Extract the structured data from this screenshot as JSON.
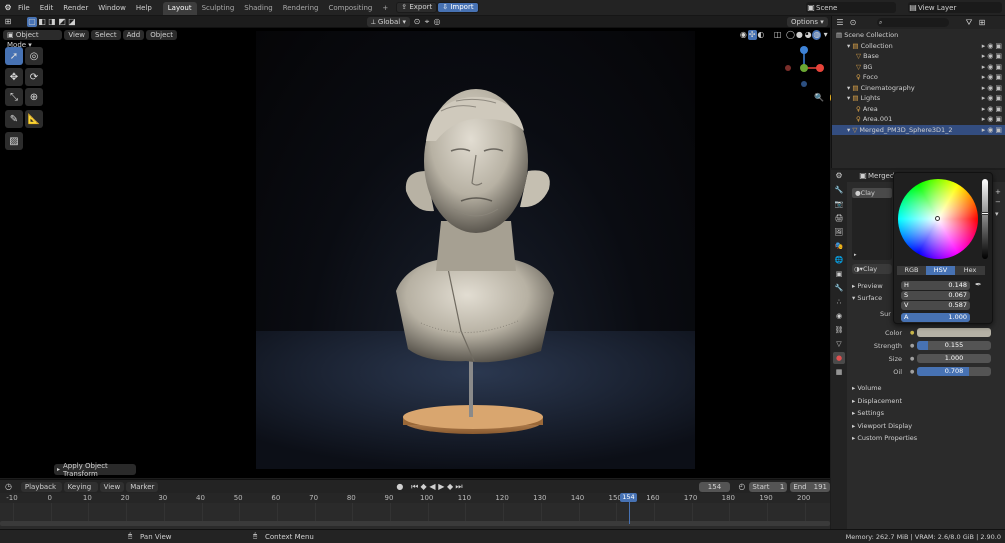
{
  "topbar": {
    "menus": [
      "File",
      "Edit",
      "Render",
      "Window",
      "Help"
    ],
    "workspaces": [
      "Layout",
      "Sculpting",
      "Shading",
      "Rendering",
      "Compositing"
    ],
    "active_workspace": "Layout",
    "add_workspace": "+",
    "export_label": "Export",
    "import_label": "Import",
    "scene_label": "Scene",
    "view_layer_label": "View Layer"
  },
  "viewport": {
    "mode": "Object Mode",
    "menus": [
      "View",
      "Select",
      "Add",
      "Object"
    ],
    "orientation": "Global",
    "options_label": "Options",
    "operator_panel": "Apply Object Transform",
    "gizmo_axes": [
      "X",
      "Y",
      "Z"
    ]
  },
  "timeline": {
    "menus": [
      "Playback",
      "Keying",
      "View",
      "Marker"
    ],
    "current_frame": "154",
    "start_label": "Start",
    "start": "1",
    "end_label": "End",
    "end": "191",
    "ruler": [
      "-10",
      "0",
      "10",
      "20",
      "30",
      "40",
      "50",
      "60",
      "70",
      "80",
      "90",
      "100",
      "110",
      "120",
      "130",
      "140",
      "150",
      "160",
      "170",
      "180",
      "190",
      "200"
    ],
    "playhead_label": "154"
  },
  "statusbar": {
    "left_hint": "Pan View",
    "right_hint": "Context Menu",
    "memory": "Memory: 262.7 MiB | VRAM: 2.6/8.0 GiB | 2.90.0"
  },
  "outliner": {
    "root": "Scene Collection",
    "rows": [
      {
        "label": "Collection",
        "indent": 1,
        "selected": false
      },
      {
        "label": "Base",
        "indent": 2,
        "selected": false
      },
      {
        "label": "BG",
        "indent": 2,
        "selected": false
      },
      {
        "label": "Foco",
        "indent": 2,
        "selected": false
      },
      {
        "label": "Cinematography",
        "indent": 1,
        "selected": false
      },
      {
        "label": "Lights",
        "indent": 1,
        "selected": false
      },
      {
        "label": "Area",
        "indent": 2,
        "selected": false
      },
      {
        "label": "Area.001",
        "indent": 2,
        "selected": false
      },
      {
        "label": "Merged_PM3D_Sphere3D1_2",
        "indent": 1,
        "selected": true
      }
    ]
  },
  "properties": {
    "object_name": "Merged",
    "material_slot": "Clay",
    "material_name": "Clay",
    "preview_label": "Preview",
    "surface_label": "Surface",
    "surface_field_label": "Sur",
    "color_label": "Color",
    "color_value": "#b6b2a6",
    "strength_label": "Strength",
    "strength": "0.155",
    "strength_fraction": 0.155,
    "size_label": "Size",
    "size": "1.000",
    "size_fraction": 0.0,
    "oil_label": "Oil",
    "oil": "0.708",
    "oil_fraction": 0.708,
    "sections": [
      "Volume",
      "Displacement",
      "Settings",
      "Viewport Display",
      "Custom Properties"
    ]
  },
  "color_picker": {
    "modes": [
      "RGB",
      "HSV",
      "Hex"
    ],
    "active_mode": "HSV",
    "h_label": "H",
    "h": "0.148",
    "s_label": "S",
    "s": "0.067",
    "v_label": "V",
    "v": "0.587",
    "a_label": "A",
    "a": "1.000",
    "a_fraction": 1.0
  },
  "colors": {
    "accent": "#4772b3",
    "axis_x": "#e8443a",
    "axis_y": "#6ba833",
    "axis_z": "#3e83d8"
  }
}
